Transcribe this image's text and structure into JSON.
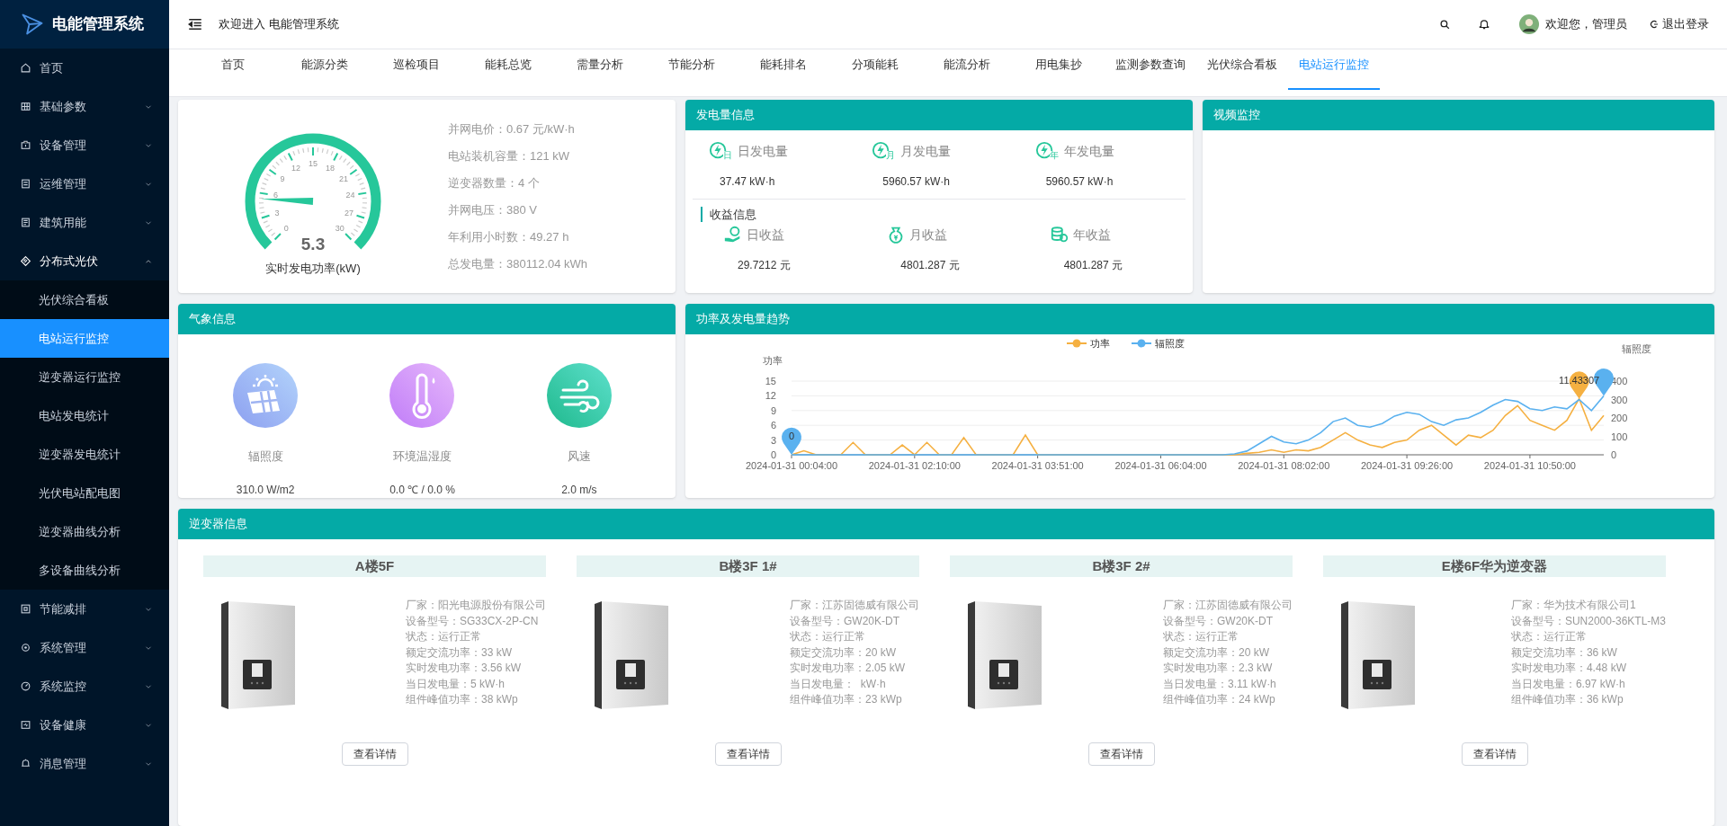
{
  "app": {
    "title": "电能管理系统"
  },
  "header": {
    "welcome": "欢迎进入 电能管理系统",
    "user": "欢迎您，管理员",
    "logout": "退出登录"
  },
  "sidebar": {
    "items": [
      {
        "label": "首页",
        "kind": "link"
      },
      {
        "label": "基础参数",
        "kind": "group",
        "expanded": false
      },
      {
        "label": "设备管理",
        "kind": "group",
        "expanded": false
      },
      {
        "label": "运维管理",
        "kind": "group",
        "expanded": false
      },
      {
        "label": "建筑用能",
        "kind": "group",
        "expanded": false
      },
      {
        "label": "分布式光伏",
        "kind": "group",
        "expanded": true,
        "children": [
          {
            "label": "光伏综合看板",
            "selected": false
          },
          {
            "label": "电站运行监控",
            "selected": true
          },
          {
            "label": "逆变器运行监控",
            "selected": false
          },
          {
            "label": "电站发电统计",
            "selected": false
          },
          {
            "label": "逆变器发电统计",
            "selected": false
          },
          {
            "label": "光伏电站配电图",
            "selected": false
          },
          {
            "label": "逆变器曲线分析",
            "selected": false
          },
          {
            "label": "多设备曲线分析",
            "selected": false
          }
        ]
      },
      {
        "label": "节能减排",
        "kind": "group",
        "expanded": false
      },
      {
        "label": "系统管理",
        "kind": "group",
        "expanded": false
      },
      {
        "label": "系统监控",
        "kind": "group",
        "expanded": false
      },
      {
        "label": "设备健康",
        "kind": "group",
        "expanded": false
      },
      {
        "label": "消息管理",
        "kind": "group",
        "expanded": false
      }
    ]
  },
  "tabs": [
    {
      "label": "首页",
      "selected": false
    },
    {
      "label": "能源分类",
      "selected": false
    },
    {
      "label": "巡检项目",
      "selected": false
    },
    {
      "label": "能耗总览",
      "selected": false
    },
    {
      "label": "需量分析",
      "selected": false
    },
    {
      "label": "节能分析",
      "selected": false
    },
    {
      "label": "能耗排名",
      "selected": false
    },
    {
      "label": "分项能耗",
      "selected": false
    },
    {
      "label": "能流分析",
      "selected": false
    },
    {
      "label": "用电集抄",
      "selected": false
    },
    {
      "label": "监测参数查询",
      "selected": false
    },
    {
      "label": "光伏综合看板",
      "selected": false
    },
    {
      "label": "电站运行监控",
      "selected": true
    }
  ],
  "gauge": {
    "value": "5.3",
    "level": 0.1767,
    "caption": "实时发电功率(kW)",
    "scale": [
      "0",
      "3",
      "6",
      "9",
      "12",
      "15",
      "18",
      "21",
      "24",
      "27",
      "30"
    ],
    "facts": [
      "并网电价：0.67 元/kW·h",
      "电站装机容量：121 kW",
      "逆变器数量：4 个",
      "并网电压：380 V",
      "年利用小时数：49.27 h",
      "总发电量：380112.04 kWh"
    ]
  },
  "generation": {
    "title": "发电量信息",
    "energy": [
      {
        "label": "日发电量",
        "value": "37.47 kW·h",
        "badge": "日"
      },
      {
        "label": "月发电量",
        "value": "5960.57 kW·h",
        "badge": "月"
      },
      {
        "label": "年发电量",
        "value": "5960.57 kW·h",
        "badge": "年"
      }
    ],
    "income_title": "收益信息",
    "income": [
      {
        "label": "日收益",
        "value": "29.7212 元"
      },
      {
        "label": "月收益",
        "value": "4801.287 元"
      },
      {
        "label": "年收益",
        "value": "4801.287 元"
      }
    ]
  },
  "video": {
    "title": "视频监控"
  },
  "weather": {
    "title": "气象信息",
    "items": [
      {
        "label": "辐照度",
        "value": "310.0 W/m2"
      },
      {
        "label": "环境温湿度",
        "value": "0.0 ℃ / 0.0 %"
      },
      {
        "label": "风速",
        "value": "2.0 m/s"
      }
    ]
  },
  "trend": {
    "title": "功率及发电量趋势",
    "chart_data": {
      "type": "line",
      "ylabel": "功率",
      "y2label": "辐照度",
      "categories": [
        "2024-01-31 00:04:00",
        null,
        null,
        null,
        null,
        null,
        null,
        null,
        null,
        null,
        "2024-01-31 02:10:00",
        null,
        null,
        null,
        null,
        null,
        null,
        null,
        null,
        null,
        "2024-01-31 03:51:00",
        null,
        null,
        null,
        null,
        null,
        null,
        null,
        null,
        null,
        "2024-01-31 06:04:00",
        null,
        null,
        null,
        null,
        null,
        null,
        null,
        null,
        null,
        "2024-01-31 08:02:00",
        null,
        null,
        null,
        null,
        null,
        null,
        null,
        null,
        null,
        "2024-01-31 09:26:00",
        null,
        null,
        null,
        null,
        null,
        null,
        null,
        null,
        null,
        "2024-01-31 10:50:00",
        null,
        null,
        null,
        null,
        null,
        null
      ],
      "grid": true,
      "legend": "top",
      "ylim": [
        0,
        15
      ],
      "yticks": [
        0,
        3,
        6,
        9,
        12,
        15
      ],
      "y2lim": [
        0,
        400
      ],
      "y2ticks": [
        0,
        100,
        200,
        300,
        400
      ],
      "series": [
        {
          "name": "功率",
          "color": "#f5b041",
          "values": [
            0,
            0.8,
            0,
            0,
            0,
            2.5,
            0,
            0,
            0,
            2,
            0,
            2.5,
            0,
            0,
            3.5,
            0,
            0,
            0,
            0,
            4,
            0,
            0,
            0,
            0,
            0,
            0,
            0,
            0,
            0,
            0,
            0,
            0,
            0,
            0,
            0,
            0,
            0,
            0.3,
            0.5,
            1,
            0.5,
            1,
            0.8,
            1.5,
            3,
            4.5,
            3,
            2,
            1.5,
            2.5,
            3,
            5,
            6,
            4,
            2,
            4,
            3.5,
            5,
            8,
            10,
            7,
            6,
            5,
            7,
            11.4,
            5,
            8
          ]
        },
        {
          "name": "辐照度",
          "color": "#5ab1ef",
          "axis": "y2",
          "values": [
            0,
            0,
            0,
            0,
            0,
            0,
            0,
            0,
            0,
            0,
            0,
            0,
            0,
            0,
            0,
            0,
            0,
            0,
            0,
            0,
            0,
            0,
            0,
            0,
            0,
            0,
            0,
            0,
            0,
            0,
            0,
            0,
            0,
            0,
            0,
            0,
            5,
            20,
            60,
            100,
            70,
            60,
            80,
            120,
            180,
            200,
            160,
            150,
            170,
            210,
            230,
            220,
            180,
            160,
            190,
            200,
            230,
            270,
            300,
            290,
            250,
            240,
            260,
            250,
            300,
            240,
            320
          ]
        }
      ]
    },
    "markers": [
      {
        "kind": "y2min",
        "text": "0"
      },
      {
        "kind": "max",
        "text": "11.43307"
      },
      {
        "kind": "y2max"
      }
    ]
  },
  "inverters": {
    "title": "逆变器信息",
    "items": [
      {
        "name": "A楼5F",
        "button": "查看详情",
        "details": [
          "厂家：阳光电源股份有限公司",
          "设备型号：SG33CX-2P-CN",
          "状态：运行正常",
          "额定交流功率：33 kW",
          "实时发电功率：3.56 kW",
          "当日发电量：5 kW·h",
          "组件峰值功率：38 kWp"
        ]
      },
      {
        "name": "B楼3F 1#",
        "button": "查看详情",
        "details": [
          "厂家：江苏固德威有限公司",
          "设备型号：GW20K-DT",
          "状态：运行正常",
          "额定交流功率：20 kW",
          "实时发电功率：2.05 kW",
          "当日发电量：  kW·h",
          "组件峰值功率：23 kWp"
        ]
      },
      {
        "name": "B楼3F 2#",
        "button": "查看详情",
        "details": [
          "厂家：江苏固德威有限公司",
          "设备型号：GW20K-DT",
          "状态：运行正常",
          "额定交流功率：20 kW",
          "实时发电功率：2.3 kW",
          "当日发电量：3.11 kW·h",
          "组件峰值功率：24 kWp"
        ]
      },
      {
        "name": "E楼6F华为逆变器",
        "button": "查看详情",
        "details": [
          "厂家：华为技术有限公司1",
          "设备型号：SUN2000-36KTL-M3",
          "状态：运行正常",
          "额定交流功率：36 kW",
          "实时发电功率：4.48 kW",
          "当日发电量：6.97 kW·h",
          "组件峰值功率：36 kWp"
        ]
      }
    ]
  }
}
